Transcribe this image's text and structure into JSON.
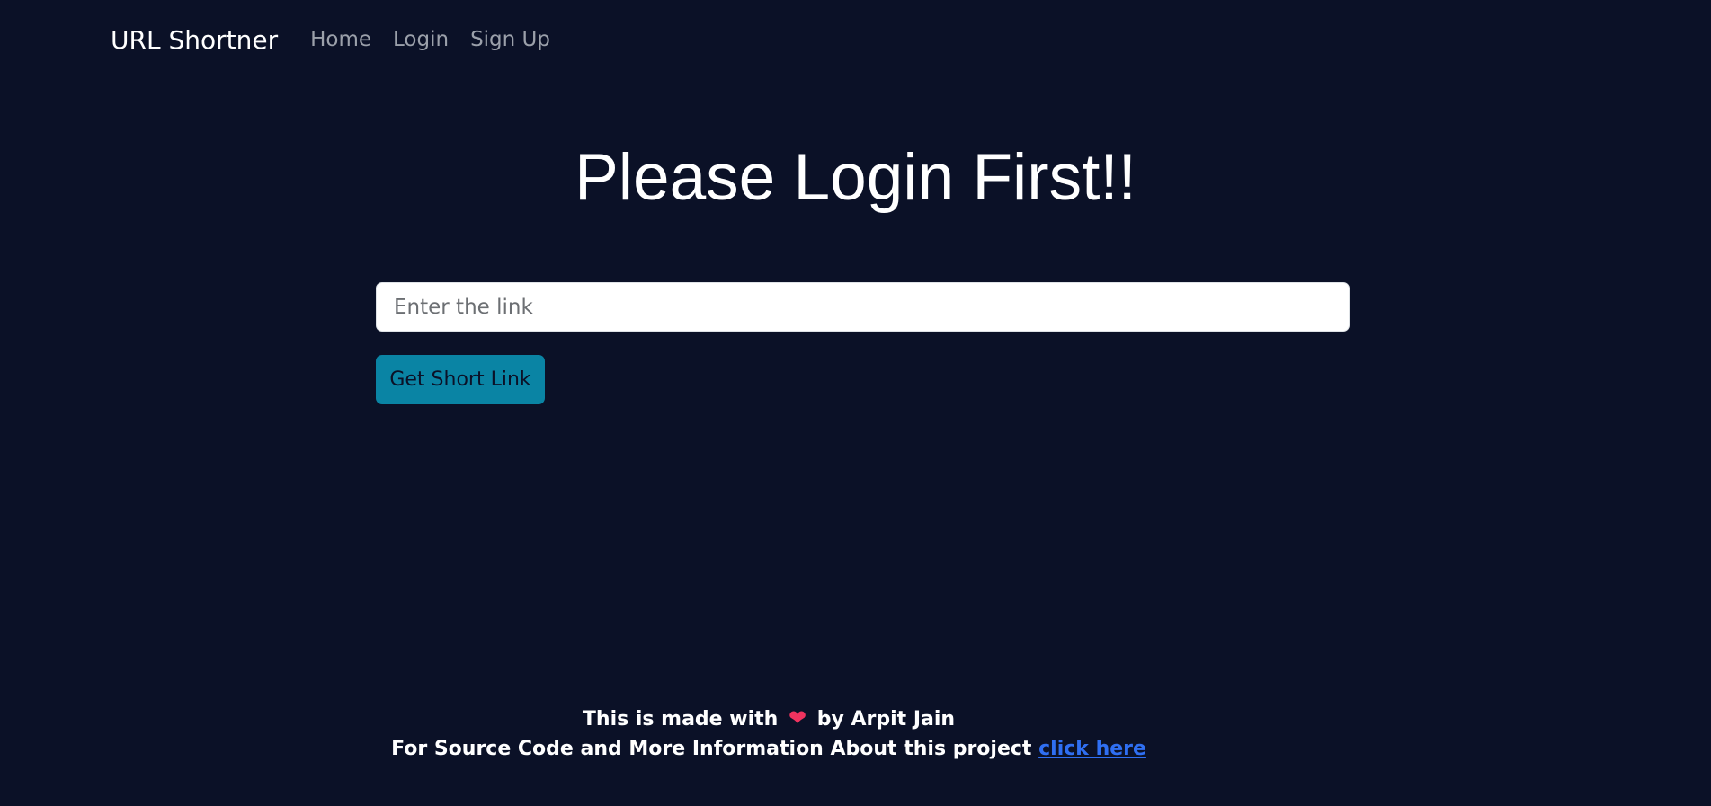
{
  "navbar": {
    "brand": "URL Shortner",
    "links": [
      {
        "label": "Home"
      },
      {
        "label": "Login"
      },
      {
        "label": "Sign Up"
      }
    ]
  },
  "main": {
    "title": "Please Login First!!",
    "link_input": {
      "value": "",
      "placeholder": "Enter the link"
    },
    "submit_label": "Get Short Link"
  },
  "footer": {
    "made_with_prefix": "This is made with",
    "made_with_icon": "heart-icon",
    "made_with_suffix": "by Arpit Jain",
    "source_text": "For Source Code and More Information About this project",
    "source_link_label": "click here"
  },
  "colors": {
    "background": "#0b1127",
    "button": "#0a84a4",
    "link": "#2f6ff2",
    "heart": "#f0335f",
    "nav_link": "#9ba0aa"
  }
}
